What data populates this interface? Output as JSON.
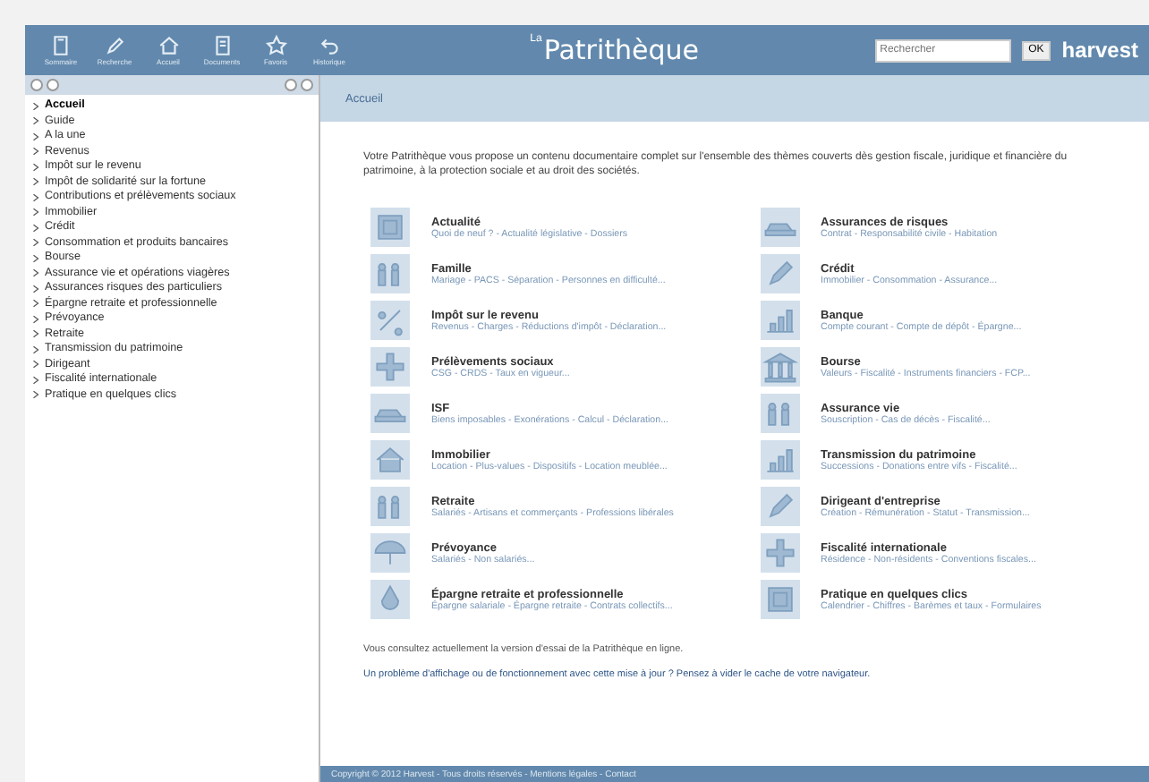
{
  "toolbar": [
    {
      "label": "Sommaire",
      "kind": "book"
    },
    {
      "label": "Recherche",
      "kind": "pen"
    },
    {
      "label": "Accueil",
      "kind": "home"
    },
    {
      "label": "Documents",
      "kind": "doc"
    },
    {
      "label": "Favoris",
      "kind": "star"
    },
    {
      "label": "Historique",
      "kind": "undo"
    }
  ],
  "app_title": "Patrithèque",
  "app_title_prefix": "La",
  "search": {
    "placeholder": "Rechercher"
  },
  "search_button": "OK",
  "logo": "harvest",
  "sidebar": {
    "items": [
      {
        "label": "Accueil",
        "selected": true
      },
      {
        "label": "Guide",
        "selected": false
      },
      {
        "label": "A la une",
        "selected": false
      },
      {
        "label": "Revenus",
        "selected": false
      },
      {
        "label": "Impôt sur le revenu",
        "selected": false
      },
      {
        "label": "Impôt de solidarité sur la fortune",
        "selected": false
      },
      {
        "label": "Contributions et prélèvements sociaux",
        "selected": false
      },
      {
        "label": "Immobilier",
        "selected": false
      },
      {
        "label": "Crédit",
        "selected": false
      },
      {
        "label": "Consommation et produits bancaires",
        "selected": false
      },
      {
        "label": "Bourse",
        "selected": false
      },
      {
        "label": "Assurance vie et opérations viagères",
        "selected": false
      },
      {
        "label": "Assurances risques des particuliers",
        "selected": false
      },
      {
        "label": "Épargne retraite et professionnelle",
        "selected": false
      },
      {
        "label": "Prévoyance",
        "selected": false
      },
      {
        "label": "Retraite",
        "selected": false
      },
      {
        "label": "Transmission du patrimoine",
        "selected": false
      },
      {
        "label": "Dirigeant",
        "selected": false
      },
      {
        "label": "Fiscalité internationale",
        "selected": false
      },
      {
        "label": "Pratique en quelques clics",
        "selected": false
      }
    ]
  },
  "page_title": "Accueil",
  "intro": "Votre Patrithèque vous propose un contenu documentaire complet sur l'ensemble des thèmes couverts dès gestion fiscale, juridique et financière du patrimoine, à la protection sociale et au droit des sociétés.",
  "topics": [
    {
      "title": "Actualité",
      "subtitle": "Quoi de neuf ? - Actualité législative - Dossiers",
      "kind": "frame"
    },
    {
      "title": "Assurances de risques",
      "subtitle": "Contrat - Responsabilité civile - Habitation",
      "kind": "car"
    },
    {
      "title": "Famille",
      "subtitle": "Mariage - PACS - Séparation - Personnes en difficulté...",
      "kind": "people"
    },
    {
      "title": "Crédit",
      "subtitle": "Immobilier - Consommation - Assurance...",
      "kind": "pen"
    },
    {
      "title": "Impôt sur le revenu",
      "subtitle": "Revenus - Charges - Réductions d'impôt - Déclaration...",
      "kind": "percent"
    },
    {
      "title": "Banque",
      "subtitle": "Compte courant - Compte de dépôt - Épargne...",
      "kind": "chart"
    },
    {
      "title": "Prélèvements sociaux",
      "subtitle": "CSG - CRDS - Taux en vigueur...",
      "kind": "cross"
    },
    {
      "title": "Bourse",
      "subtitle": "Valeurs - Fiscalité - Instruments financiers - FCP...",
      "kind": "bank"
    },
    {
      "title": "ISF",
      "subtitle": "Biens imposables - Exonérations - Calcul - Déclaration...",
      "kind": "car"
    },
    {
      "title": "Assurance vie",
      "subtitle": "Souscription - Cas de décès - Fiscalité...",
      "kind": "people"
    },
    {
      "title": "Immobilier",
      "subtitle": "Location - Plus-values - Dispositifs - Location meublée...",
      "kind": "home"
    },
    {
      "title": "Transmission du patrimoine",
      "subtitle": "Successions - Donations entre vifs - Fiscalité...",
      "kind": "chart"
    },
    {
      "title": "Retraite",
      "subtitle": "Salariés - Artisans et commerçants - Professions libérales",
      "kind": "people"
    },
    {
      "title": "Dirigeant d'entreprise",
      "subtitle": "Création - Rémunération - Statut - Transmission...",
      "kind": "pen"
    },
    {
      "title": "Prévoyance",
      "subtitle": "Salariés - Non salariés...",
      "kind": "umbrella"
    },
    {
      "title": "Fiscalité internationale",
      "subtitle": "Résidence - Non-résidents - Conventions fiscales...",
      "kind": "cross"
    },
    {
      "title": "Épargne retraite et professionnelle",
      "subtitle": "Épargne salariale - Épargne retraite - Contrats collectifs...",
      "kind": "drop"
    },
    {
      "title": "Pratique en quelques clics",
      "subtitle": "Calendrier - Chiffres - Barèmes et taux - Formulaires",
      "kind": "frame"
    }
  ],
  "notice": "Vous consultez actuellement la version d'essai de la Patrithèque en ligne.",
  "help": "Un problème d'affichage ou de fonctionnement avec cette mise à jour ? Pensez à vider le cache de votre navigateur.",
  "footer": "Copyright © 2012 Harvest - Tous droits réservés - Mentions légales - Contact"
}
